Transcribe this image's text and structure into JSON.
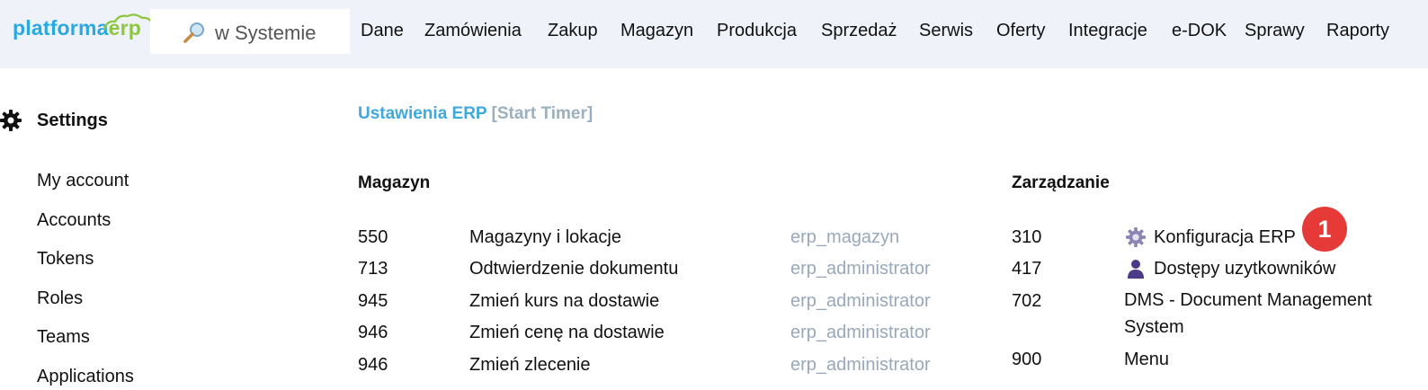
{
  "header": {
    "logo_part1": "platforma",
    "logo_part2": "erp",
    "search_placeholder": "w Systemie",
    "search_icon": "magnifier-icon",
    "nav": [
      "Dane",
      "Zamówienia",
      "Zakup",
      "Magazyn",
      "Produkcja",
      "Sprzedaż",
      "Serwis",
      "Oferty",
      "Integracje",
      "e-DOK",
      "Sprawy",
      "Raporty"
    ]
  },
  "sidebar": {
    "title": "Settings",
    "title_icon": "gear-icon",
    "items": [
      "My account",
      "Accounts",
      "Tokens",
      "Roles",
      "Teams",
      "Applications"
    ]
  },
  "main": {
    "heading_link": "Ustawienia ERP",
    "heading_timer": "[Start Timer]",
    "magazyn": {
      "title": "Magazyn",
      "rows": [
        {
          "code": "550",
          "name": "Magazyny i lokacje",
          "role": "erp_magazyn"
        },
        {
          "code": "713",
          "name": "Odtwierdzenie dokumentu",
          "role": "erp_administrator"
        },
        {
          "code": "945",
          "name": "Zmień kurs na dostawie",
          "role": "erp_administrator"
        },
        {
          "code": "946",
          "name": "Zmień cenę na dostawie",
          "role": "erp_administrator"
        },
        {
          "code": "946",
          "name": "Zmień zlecenie",
          "role": "erp_administrator"
        }
      ]
    },
    "zarzadzanie": {
      "title": "Zarządzanie",
      "rows": [
        {
          "code": "310",
          "name": "Konfiguracja ERP",
          "icon": "gear-icon"
        },
        {
          "code": "417",
          "name": "Dostępy uzytkowników",
          "icon": "user-icon"
        },
        {
          "code": "702",
          "name": "DMS - Document Management System"
        },
        {
          "code": "900",
          "name": "Menu"
        }
      ]
    },
    "badge": "1"
  },
  "colors": {
    "topbar_bg": "#eff2f8",
    "link": "#3fa9dc",
    "role": "#98a8ba",
    "badge": "#e53a37"
  }
}
